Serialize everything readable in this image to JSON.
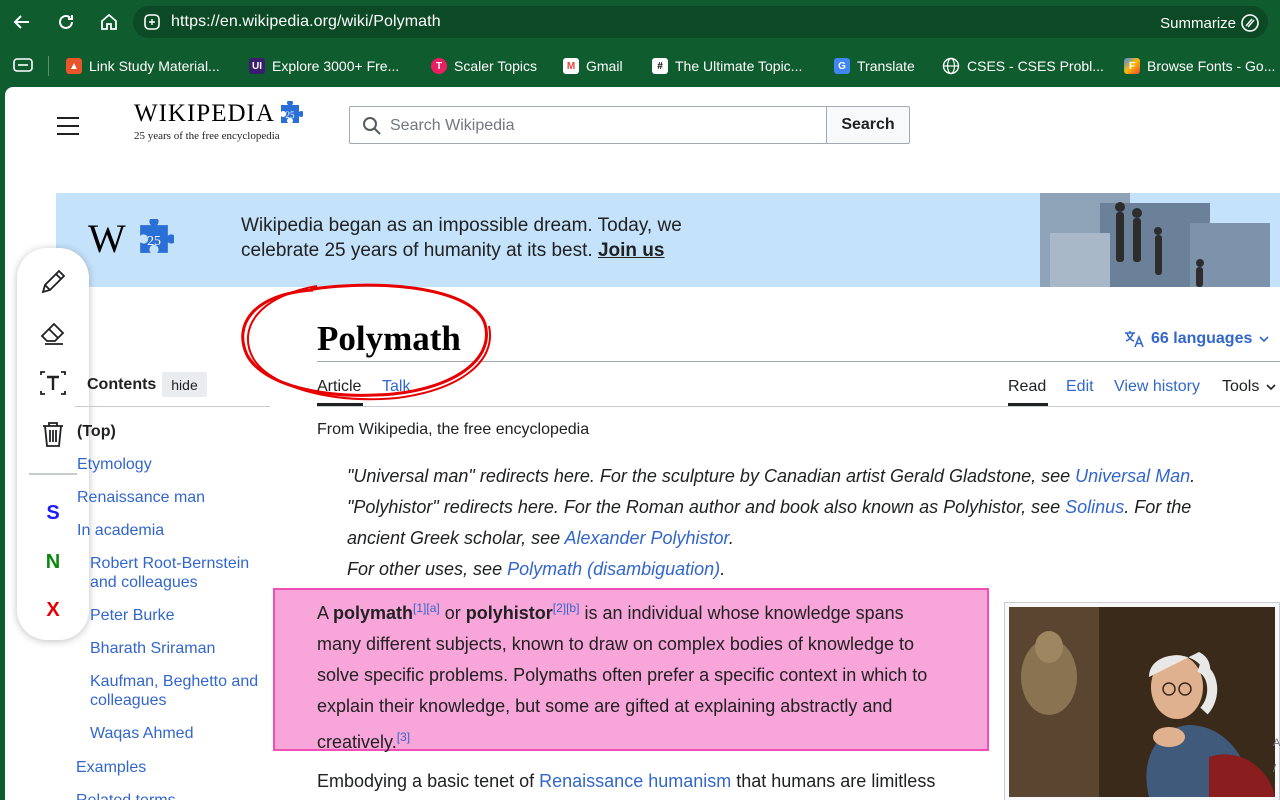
{
  "browser": {
    "url": "https://en.wikipedia.org/wiki/Polymath",
    "summarize_label": "Summarize",
    "bookmarks": [
      {
        "label": "Link Study Material...",
        "icon": "flame-icon",
        "color": "#e8552b"
      },
      {
        "label": "Explore 3000+ Fre...",
        "icon": "ui-icon",
        "color": "#3b1d6e"
      },
      {
        "label": "Scaler Topics",
        "icon": "scaler-icon",
        "color": "#e91e63"
      },
      {
        "label": "Gmail",
        "icon": "gmail-icon",
        "color": "#ea4335"
      },
      {
        "label": "The Ultimate Topic...",
        "icon": "hash-icon",
        "color": "#ffffff"
      },
      {
        "label": "Translate",
        "icon": "translate-icon",
        "color": "#4285f4"
      },
      {
        "label": "CSES - CSES Probl...",
        "icon": "globe-icon",
        "color": "#ffffff"
      },
      {
        "label": "Browse Fonts - Go...",
        "icon": "fonts-icon",
        "color": "#fbbc04"
      }
    ]
  },
  "header": {
    "wordmark": "WIKIPEDIA",
    "tagline": "25 years of the free encyclopedia",
    "search_placeholder": "Search Wikipedia",
    "search_button": "Search"
  },
  "banner": {
    "text": "Wikipedia began as an impossible dream. Today, we celebrate 25 years of humanity at its best.",
    "link": "Join us"
  },
  "drawing_toolbar": {
    "letters": [
      {
        "label": "S",
        "color": "#1a1aff"
      },
      {
        "label": "N",
        "color": "#0a8a0a"
      },
      {
        "label": "X",
        "color": "#e60000"
      }
    ]
  },
  "toc": {
    "heading": "Contents",
    "hide_label": "hide",
    "items": [
      {
        "label": "(Top)"
      },
      {
        "label": "Etymology"
      },
      {
        "label": "Renaissance man"
      },
      {
        "label": "In academia"
      },
      {
        "label": "Robert Root-Bernstein and colleagues"
      },
      {
        "label": "Peter Burke"
      },
      {
        "label": "Bharath Sriraman"
      },
      {
        "label": "Kaufman, Beghetto and colleagues"
      },
      {
        "label": "Waqas Ahmed"
      },
      {
        "label": "Examples"
      },
      {
        "label": "Related terms"
      }
    ]
  },
  "article": {
    "title": "Polymath",
    "languages": "66 languages",
    "tabs": {
      "article": "Article",
      "talk": "Talk"
    },
    "actions": {
      "read": "Read",
      "edit": "Edit",
      "history": "View history",
      "tools": "Tools"
    },
    "from": "From Wikipedia, the free encyclopedia",
    "hatnotes": {
      "h1_text": "\"Universal man\" redirects here. For the sculpture by Canadian artist Gerald Gladstone, see ",
      "h1_link": "Universal Man",
      "h2_text": "\"Polyhistor\" redirects here. For the Roman author and book also known as Polyhistor, see ",
      "h2_link": "Solinus",
      "h2_text2": ". For the",
      "h3_text": "ancient Greek scholar, see ",
      "h3_link": "Alexander Polyhistor",
      "h4_text": "For other uses, see ",
      "h4_link": "Polymath (disambiguation)"
    },
    "lead": {
      "a": "A ",
      "term1": "polymath",
      "ref1": "[1][a]",
      "or": " or ",
      "term2": "polyhistor",
      "ref2": "[2][b]",
      "rest1": " is an individual whose knowledge spans",
      "line2": "many different subjects, known to draw on complex bodies of knowledge to",
      "line3": "solve specific problems. Polymaths often prefer a specific context in which to",
      "line4": "explain their knowledge, but some are gifted at explaining abstractly and",
      "line5": "creatively.",
      "ref3": "[3]"
    },
    "second": {
      "a": "Embodying a basic tenet of ",
      "link": "Renaissance humanism",
      "rest": " that humans are limitless"
    }
  }
}
